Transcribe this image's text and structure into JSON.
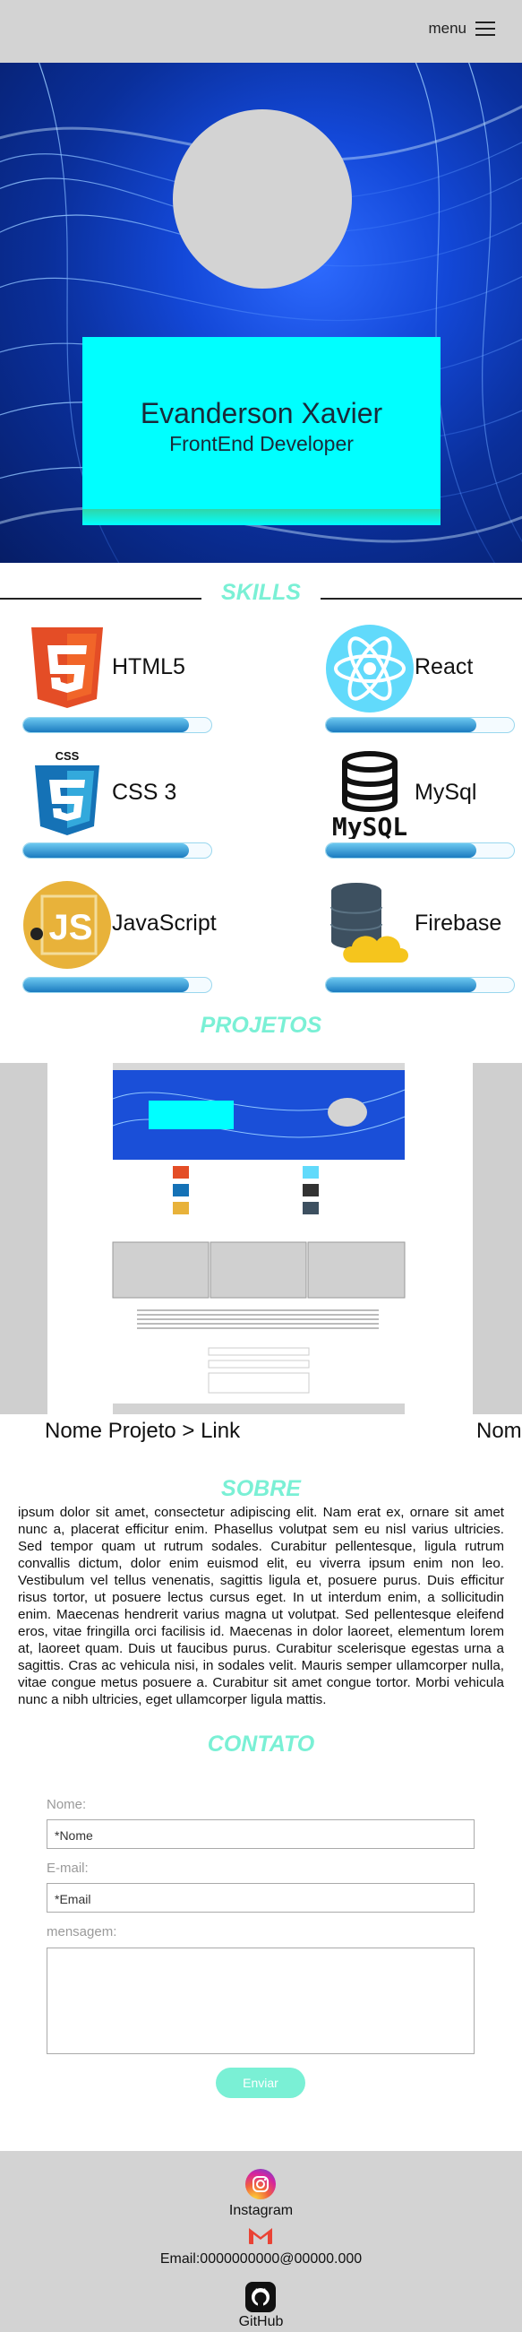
{
  "nav": {
    "menu_label": "menu"
  },
  "hero": {
    "name": "Evanderson Xavier",
    "role": "FrontEnd Developer"
  },
  "skills": {
    "title": "SKILLS",
    "items": [
      {
        "label": "HTML5",
        "level": 0.88,
        "icon": "html5-icon"
      },
      {
        "label": "React",
        "level": 0.8,
        "icon": "react-icon"
      },
      {
        "label": "CSS 3",
        "level": 0.88,
        "icon": "css3-icon"
      },
      {
        "label": "MySql",
        "level": 0.8,
        "icon": "mysql-icon"
      },
      {
        "label": "JavaScript",
        "level": 0.88,
        "icon": "javascript-icon"
      },
      {
        "label": "Firebase",
        "level": 0.8,
        "icon": "firebase-icon"
      }
    ]
  },
  "projects": {
    "title": "PROJETOS",
    "items": [
      {
        "label": "Nome Projeto > Link"
      },
      {
        "label": "Nom"
      }
    ]
  },
  "about": {
    "title": "SOBRE",
    "text": "ipsum dolor sit amet, consectetur adipiscing elit. Nam erat ex, ornare sit amet nunc a, placerat efficitur enim. Phasellus volutpat sem eu nisl varius ultricies. Sed tempor quam ut rutrum sodales. Curabitur pellentesque, ligula rutrum convallis dictum, dolor enim euismod elit, eu viverra ipsum enim non leo. Vestibulum vel tellus venenatis, sagittis ligula et, posuere purus. Duis efficitur risus tortor, ut posuere lectus cursus eget. In ut interdum enim, a sollicitudin enim. Maecenas hendrerit varius magna ut volutpat. Sed pellentesque eleifend eros, vitae fringilla orci facilisis id. Maecenas in dolor laoreet, elementum lorem at, laoreet quam. Duis ut faucibus purus. Curabitur scelerisque egestas urna a sagittis. Cras ac vehicula nisi, in sodales velit. Mauris semper ullamcorper nulla, vitae congue metus posuere a. Curabitur sit amet congue tortor. Morbi vehicula nunc a nibh ultricies, eget ullamcorper ligula mattis."
  },
  "contact": {
    "title": "CONTATO",
    "name_label": "Nome:",
    "name_placeholder": "*Nome",
    "email_label": "E-mail:",
    "email_placeholder": "*Email",
    "message_label": "mensagem:",
    "send_label": "Enviar"
  },
  "footer": {
    "instagram_label": "Instagram",
    "email_label": "Email:0000000000@00000.000",
    "github_label": "GitHub"
  },
  "colors": {
    "accent": "#7af0d5",
    "hero_card": "#00ffff",
    "topbar": "#d3d3d3"
  }
}
